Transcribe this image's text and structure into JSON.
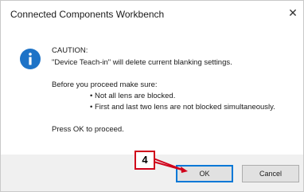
{
  "window": {
    "title": "Connected Components Workbench",
    "close_glyph": "✕"
  },
  "message": {
    "icon": "info-icon",
    "heading": "CAUTION:",
    "line1": "\"Device Teach-in\" will delete current blanking settings.",
    "before_text": "Before you proceed make sure:",
    "bullets": [
      "• Not all lens are blocked.",
      "• First and last two lens are not blocked simultaneously."
    ],
    "prompt": "Press OK to proceed."
  },
  "buttons": {
    "ok_label": "OK",
    "cancel_label": "Cancel"
  },
  "callout": {
    "number": "4",
    "color": "#d0021b"
  },
  "colors": {
    "info_icon": "#1e73c7",
    "ok_border": "#0078d7"
  }
}
